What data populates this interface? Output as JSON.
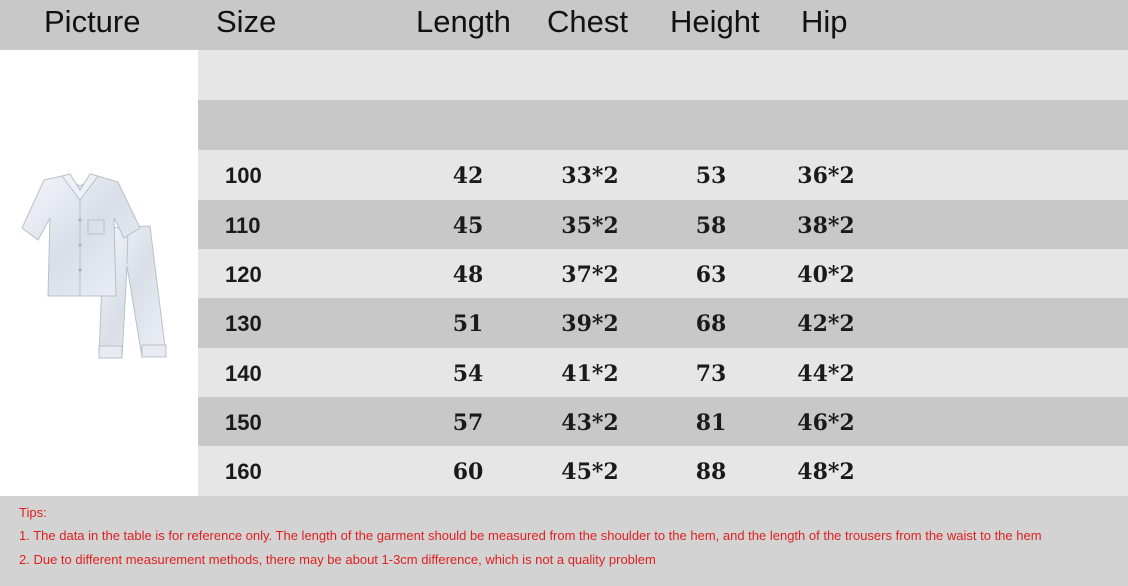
{
  "headers": [
    "Picture",
    "Size",
    "Length",
    "Chest",
    "Height",
    "Hip"
  ],
  "rows": [
    {
      "size": "100",
      "length": "42",
      "chest": "33*2",
      "height": "53",
      "hip": "36*2"
    },
    {
      "size": "110",
      "length": "45",
      "chest": "35*2",
      "height": "58",
      "hip": "38*2"
    },
    {
      "size": "120",
      "length": "48",
      "chest": "37*2",
      "height": "63",
      "hip": "40*2"
    },
    {
      "size": "130",
      "length": "51",
      "chest": "39*2",
      "height": "68",
      "hip": "42*2"
    },
    {
      "size": "140",
      "length": "54",
      "chest": "41*2",
      "height": "73",
      "hip": "44*2"
    },
    {
      "size": "150",
      "length": "57",
      "chest": "43*2",
      "height": "81",
      "hip": "46*2"
    },
    {
      "size": "160",
      "length": "60",
      "chest": "45*2",
      "height": "88",
      "hip": "48*2"
    }
  ],
  "tips": {
    "title": "Tips:",
    "line1": "1. The data in the table is for reference only. The length of the garment should be measured from the shoulder to the hem, and the length of the trousers from the waist to the hem",
    "line2": "2. Due to different measurement methods, there may be about 1-3cm difference, which is not a quality problem"
  },
  "image": {
    "icon": "pajama-set-icon",
    "garment_color": "#e4e8f0"
  }
}
